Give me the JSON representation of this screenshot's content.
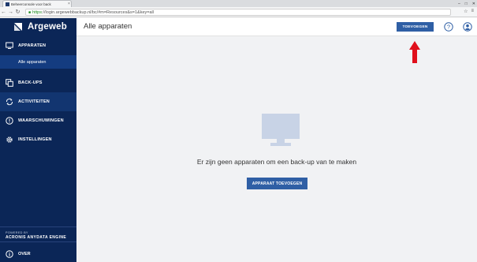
{
  "browser": {
    "tab_title": "Beheerconsole voor back",
    "tab_close": "×",
    "url_secure": "https",
    "url_rest": "://login.argewebbackup.nl/bc/#m=Resources&s=1&key=all",
    "window_controls": [
      "–",
      "□",
      "✕"
    ]
  },
  "brand": {
    "name": "Argeweb"
  },
  "sidebar": {
    "sections": [
      {
        "label": "APPARATEN",
        "icon": "monitor-icon"
      },
      {
        "label": "BACK-UPS",
        "icon": "backup-icon"
      },
      {
        "label": "ACTIVITEITEN",
        "icon": "activity-icon"
      },
      {
        "label": "WAARSCHUWINGEN",
        "icon": "alert-icon"
      },
      {
        "label": "INSTELLINGEN",
        "icon": "gear-icon"
      }
    ],
    "sub_item": "Alle apparaten",
    "powered_line1": "POWERED BY",
    "powered_line2": "ACRONIS ANYDATA ENGINE",
    "about": "OVER"
  },
  "header": {
    "title": "Alle apparaten",
    "add_button": "TOEVOEGEN"
  },
  "main": {
    "empty_message": "Er zijn geen apparaten om een back-up van te maken",
    "add_device_button": "APPARAAT TOEVOEGEN"
  },
  "colors": {
    "sidebar_bg": "#0b2657",
    "accent": "#2f5fa5",
    "annotation_arrow": "#e0101c"
  }
}
